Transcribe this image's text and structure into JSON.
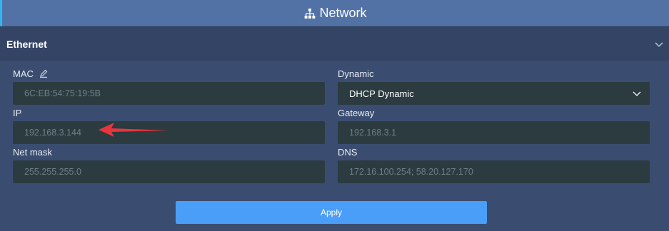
{
  "header": {
    "title": "Network",
    "icon": "network-icon"
  },
  "section": {
    "title": "Ethernet",
    "icon": "chevron-down-icon"
  },
  "fields": {
    "mac": {
      "label": "MAC",
      "value": "6C:EB:54:75:19:5B"
    },
    "dynamic": {
      "label": "Dynamic",
      "value": "DHCP Dynamic"
    },
    "ip": {
      "label": "IP",
      "value": "192.168.3.144"
    },
    "gateway": {
      "label": "Gateway",
      "value": "192.168.3.1"
    },
    "netmask": {
      "label": "Net mask",
      "value": "255.255.255.0"
    },
    "dns": {
      "label": "DNS",
      "value": "172.16.100.254; 58.20.127.170"
    }
  },
  "apply": {
    "label": "Apply"
  },
  "colors": {
    "header": "#5272a6",
    "accent": "#2eb6f0",
    "button": "#4a9ef7",
    "arrow": "#e8353b"
  }
}
